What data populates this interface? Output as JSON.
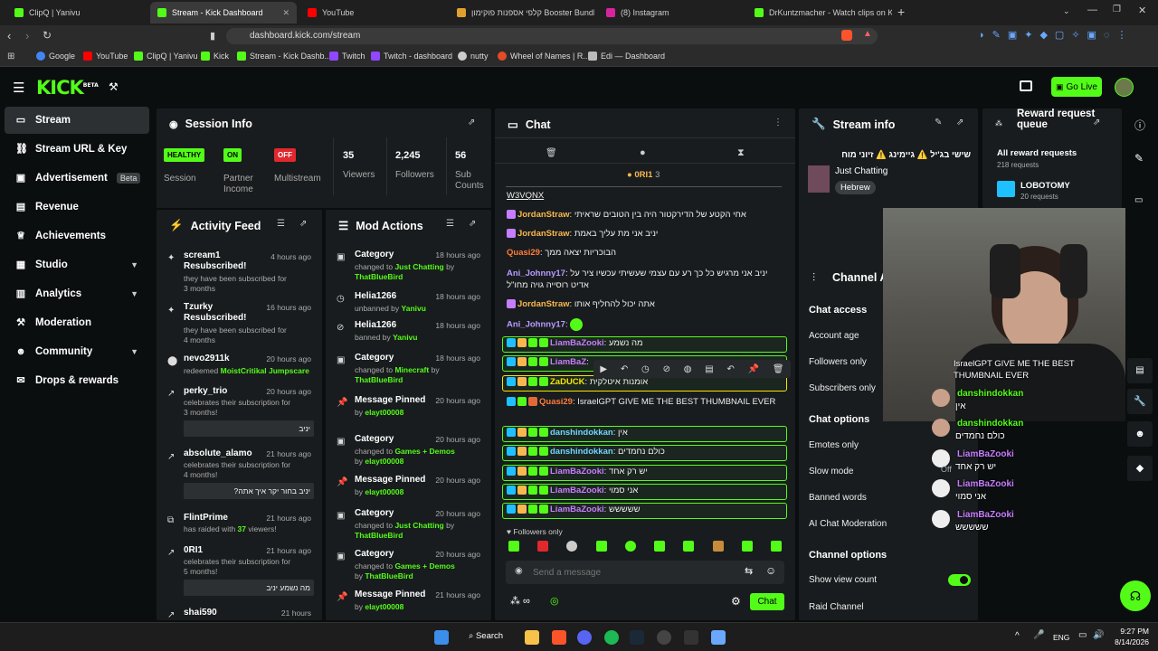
{
  "browser": {
    "tabs": [
      {
        "label": "ClipQ | Yanivu",
        "color": "#53fc18"
      },
      {
        "label": "Stream - Kick Dashboard",
        "color": "#53fc18"
      },
      {
        "label": "YouTube",
        "color": "#ff0000"
      },
      {
        "label": "קלפי אספנות פוקימון Booster Bundle",
        "color": "#e0a030"
      },
      {
        "label": "(8) Instagram",
        "color": "#d6249f"
      },
      {
        "label": "DrKuntzmacher - Watch clips on Kick",
        "color": "#53fc18"
      }
    ],
    "url": "dashboard.kick.com/stream",
    "bookmarks": [
      "Google",
      "YouTube",
      "ClipQ | Yanivu",
      "Kick",
      "Stream - Kick Dashb...",
      "Twitch",
      "Twitch - dashboard",
      "nutty",
      "Wheel of Names | R...",
      "Edi — Dashboard"
    ]
  },
  "header": {
    "logo": "KICK",
    "logo_sup": "BETA",
    "go_live": "Go Live"
  },
  "sidebar": {
    "items": [
      {
        "label": "Stream"
      },
      {
        "label": "Stream URL & Key"
      },
      {
        "label": "Advertisement",
        "badge": "Beta"
      },
      {
        "label": "Revenue"
      },
      {
        "label": "Achievements"
      },
      {
        "label": "Studio"
      },
      {
        "label": "Analytics"
      },
      {
        "label": "Moderation"
      },
      {
        "label": "Community"
      },
      {
        "label": "Drops & rewards"
      }
    ]
  },
  "session": {
    "title": "Session Info",
    "healthy": "HEALTHY",
    "session_label": "Session",
    "on": "ON",
    "partner_label": "Partner Income",
    "off": "OFF",
    "multistream_label": "Multistream",
    "viewers": "35",
    "viewers_label": "Viewers",
    "followers": "2,245",
    "followers_label": "Followers",
    "subs": "56",
    "subs_label": "Sub Counts"
  },
  "activity": {
    "title": "Activity Feed",
    "items": [
      {
        "name": "scream1 Resubscribed!",
        "desc": "they have been subscribed for 3 months",
        "time": "4 hours ago"
      },
      {
        "name": "Tzurky Resubscribed!",
        "desc": "they have been subscribed for 4 months",
        "time": "16 hours ago"
      },
      {
        "name": "nevo2911k",
        "desc": "redeemed MoistCritikal Jumpscare",
        "time": "20 hours ago"
      },
      {
        "name": "perky_trio",
        "desc": "celebrates their subscription for 3 months!",
        "time": "20 hours ago",
        "msg": "יניב"
      },
      {
        "name": "absolute_alamo",
        "desc": "celebrates their subscription for 4 months!",
        "time": "21 hours ago",
        "msg": "יניב בחור יקר איך אתה?"
      },
      {
        "name": "FlintPrime",
        "desc": "has raided with 37 viewers!",
        "time": "21 hours ago"
      },
      {
        "name": "0RI1",
        "desc": "celebrates their subscription for 5 months!",
        "time": "21 hours ago",
        "msg": "מה נשמע יניב"
      },
      {
        "name": "shai590",
        "desc": "",
        "time": "21 hours"
      }
    ]
  },
  "mod": {
    "title": "Mod Actions",
    "items": [
      {
        "name": "Category",
        "pre": "changed to ",
        "hl": "Just Chatting",
        "post": " by ",
        "by": "ThatBlueBird",
        "time": "18 hours ago"
      },
      {
        "name": "Helia1266",
        "pre": "unbanned by ",
        "hl": "",
        "post": "",
        "by": "Yanivu",
        "time": "18 hours ago"
      },
      {
        "name": "Helia1266",
        "pre": "banned by ",
        "hl": "",
        "post": "",
        "by": "Yanivu",
        "time": "18 hours ago"
      },
      {
        "name": "Category",
        "pre": "changed to ",
        "hl": "Minecraft",
        "post": " by ",
        "by": "ThatBlueBird",
        "time": "18 hours ago"
      },
      {
        "name": "Message Pinned",
        "pre": "by ",
        "hl": "",
        "post": "",
        "by": "elayt00008",
        "time": "20 hours ago"
      },
      {
        "name": "Category",
        "pre": "changed to ",
        "hl": "Games + Demos",
        "post": " by ",
        "by": "elayt00008",
        "time": "20 hours ago"
      },
      {
        "name": "Message Pinned",
        "pre": "by ",
        "hl": "",
        "post": "",
        "by": "elayt00008",
        "time": "20 hours ago"
      },
      {
        "name": "Category",
        "pre": "changed to ",
        "hl": "Just Chatting",
        "post": " by ",
        "by": "ThatBlueBird",
        "time": "20 hours ago"
      },
      {
        "name": "Category",
        "pre": "changed to ",
        "hl": "Games + Demos",
        "post": " by ",
        "by": "ThatBlueBird",
        "time": "20 hours ago"
      },
      {
        "name": "Message Pinned",
        "pre": "by ",
        "hl": "",
        "post": "",
        "by": "elayt00008",
        "time": "21 hours ago"
      }
    ]
  },
  "chat": {
    "title": "Chat",
    "pinned_user": "0RI1",
    "pinned_count": "3",
    "messages": [
      {
        "user": "",
        "text": "W3VQNX",
        "color": "#ddd"
      },
      {
        "user": "JordanStraw",
        "text": "אחי הקטע של הדירקטור היה בין הטובים שראיתי",
        "color": "#f8b84e"
      },
      {
        "user": "JordanStraw",
        "text": "יניב אני מת עליך באמת",
        "color": "#f8b84e"
      },
      {
        "user": "Quasi29",
        "text": "הבוכריות יצאה ממך",
        "color": "#ff7b3a"
      },
      {
        "user": "Ani_Johnny17",
        "text": "יניב אני מרגיש כל כך רע עם עצמי שעשיתי עכשיו ציר על אדיט רוסייה גויה מחו\"ל",
        "color": "#b79bff"
      },
      {
        "user": "JordanStraw",
        "text": "אתה יכול להחליף אותו",
        "color": "#f8b84e"
      },
      {
        "user": "Ani_Johnny17",
        "text": "",
        "color": "#b79bff"
      },
      {
        "user": "LiamBaZooki",
        "text": "מה נשמע",
        "color": "#c77dff"
      },
      {
        "user": "LiamBaZ",
        "text": "",
        "color": "#c77dff"
      },
      {
        "user": "ZaDUCK",
        "text": "אומנות איטלקית",
        "color": "#f3e600"
      },
      {
        "user": "Quasi29",
        "text": "IsraelGPT GIVE ME THE BEST THUMBNAIL EVER",
        "color": "#ff7b3a"
      },
      {
        "user": "danshindokkan",
        "text": "אין",
        "color": "#6fd5ff"
      },
      {
        "user": "danshindokkan",
        "text": "כולם נחמדים",
        "color": "#6fd5ff"
      },
      {
        "user": "LiamBaZooki",
        "text": "יש רק אחד",
        "color": "#c77dff"
      },
      {
        "user": "LiamBaZooki",
        "text": "אני סמוי",
        "color": "#c77dff"
      },
      {
        "user": "LiamBaZooki",
        "text": "ששששש",
        "color": "#c77dff"
      }
    ],
    "followers_only": "Followers only",
    "placeholder": "Send a message",
    "send": "Chat"
  },
  "stream_info": {
    "title": "Stream info",
    "stream_title": "שישי בג'יל ⚠️ גיימינג ⚠️ זיוני מוח",
    "category": "Just Chatting",
    "tag": "Hebrew"
  },
  "reward": {
    "title": "Reward request queue",
    "all": "All reward requests",
    "all_count": "218 requests",
    "item": "LOBOTOMY",
    "item_count": "20 requests"
  },
  "channel": {
    "title": "Channel A",
    "chat_access": "Chat access",
    "account_age": "Account age",
    "followers_only": "Followers only",
    "subscribers_only": "Subscribers only",
    "chat_options": "Chat options",
    "emotes_only": "Emotes only",
    "slow_mode": "Slow mode",
    "banned_words": "Banned words",
    "ai_mod": "AI Chat Moderation",
    "channel_options": "Channel options",
    "show_view": "Show view count",
    "raid": "Raid Channel",
    "off": "Off"
  },
  "overlay_chat": [
    {
      "user": "danshindokkan",
      "text": "אין"
    },
    {
      "user": "danshindokkan",
      "text": "כולם נחמדים"
    },
    {
      "user": "LiamBaZooki",
      "text": "יש רק אחד"
    },
    {
      "user": "LiamBaZooki",
      "text": "אני סמוי"
    },
    {
      "user": "LiamBaZooki",
      "text": "ששששש"
    }
  ],
  "overlay_top": "IsraelGPT GIVE ME THE BEST THUMBNAIL EVER",
  "taskbar": {
    "search": "Search",
    "lang": "ENG",
    "time": "9:27 PM",
    "date": "8/14/2026"
  },
  "colors": {
    "accent": "#53fc18",
    "bg": "#0b0e0f",
    "panel": "#191c1e"
  }
}
